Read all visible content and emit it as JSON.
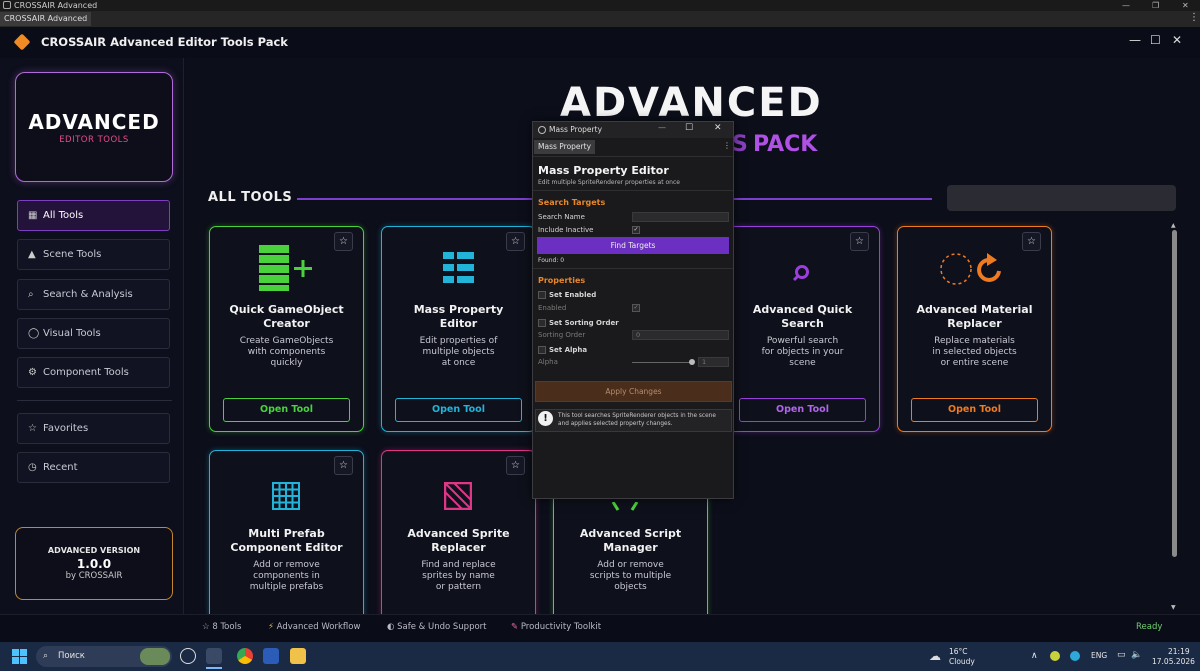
{
  "os": {
    "window_title": "CROSSAIR Advanced",
    "tab_label": "CROSSAIR Advanced"
  },
  "app": {
    "title": "CROSSAIR Advanced Editor Tools Pack",
    "minimize": "—",
    "maximize": "☐",
    "close": "✕"
  },
  "sidebar": {
    "logo_main": "ADVANCED",
    "logo_sub": "EDITOR TOOLS",
    "items": [
      {
        "icon": "▦",
        "label": "All Tools"
      },
      {
        "icon": "▲",
        "label": "Scene Tools"
      },
      {
        "icon": "⌕",
        "label": "Search & Analysis"
      },
      {
        "icon": "◯",
        "label": "Visual Tools"
      },
      {
        "icon": "⚙",
        "label": "Component Tools"
      }
    ],
    "extra": [
      {
        "icon": "☆",
        "label": "Favorites"
      },
      {
        "icon": "◷",
        "label": "Recent"
      }
    ],
    "version_label": "ADVANCED VERSION",
    "version": "1.0.0",
    "by": "by CROSSAIR"
  },
  "hero": {
    "title": "ADVANCED",
    "pack": "PACK",
    "partial": "S"
  },
  "section_title": "ALL TOOLS",
  "cards": [
    {
      "title1": "Quick GameObject",
      "title2": "Creator",
      "desc1": "Create GameObjects",
      "desc2": "with components",
      "desc3": "quickly",
      "btn": "Open Tool",
      "color": "#49d23c"
    },
    {
      "title1": "Mass Property",
      "title2": "Editor",
      "desc1": "Edit properties of",
      "desc2": "multiple objects",
      "desc3": "at once",
      "btn": "Open Tool",
      "color": "#22b4d8"
    },
    {
      "title1": "Advanced Quick",
      "title2": "Search",
      "desc1": "Powerful search",
      "desc2": "for objects in your",
      "desc3": "scene",
      "btn": "Open Tool",
      "color": "#9a3fdc"
    },
    {
      "title1": "Advanced Material",
      "title2": "Replacer",
      "desc1": "Replace materials",
      "desc2": "in selected objects",
      "desc3": "or entire scene",
      "btn": "Open Tool",
      "color": "#ee7a22"
    },
    {
      "title1": "Multi Prefab",
      "title2": "Component Editor",
      "desc1": "Add or remove",
      "desc2": "components in",
      "desc3": "multiple prefabs",
      "color": "#22b4d8"
    },
    {
      "title1": "Advanced Sprite",
      "title2": "Replacer",
      "desc1": "Find and replace",
      "desc2": "sprites by name",
      "desc3": "or pattern",
      "color": "#e0368a"
    },
    {
      "title1": "Advanced Script",
      "title2": "Manager",
      "desc1": "Add or remove",
      "desc2": "scripts to multiple",
      "desc3": "objects",
      "color": "#49d23c"
    }
  ],
  "star": "☆",
  "mass_property": {
    "window_title": "Mass Property",
    "tab": "Mass Property",
    "heading": "Mass Property Editor",
    "subheading": "Edit multiple SpriteRenderer properties at once",
    "search_section": "Search Targets",
    "search_name_label": "Search Name",
    "include_inactive_label": "Include Inactive",
    "find_button": "Find Targets",
    "found": "Found: 0",
    "properties_section": "Properties",
    "set_enabled": "Set Enabled",
    "enabled": "Enabled",
    "set_sorting_order": "Set Sorting Order",
    "sorting_order": "Sorting Order",
    "sorting_value": "0",
    "set_alpha": "Set Alpha",
    "alpha": "Alpha",
    "alpha_value": "1",
    "alpha_fraction": 1.0,
    "apply_button": "Apply Changes",
    "info_text": "This tool searches SpriteRenderer objects in the scene and applies selected property changes.",
    "check": "✓",
    "more": "⋮"
  },
  "status": {
    "items": [
      {
        "icon": "☆",
        "label": "8 Tools"
      },
      {
        "icon": "⚡",
        "label": "Advanced Workflow"
      },
      {
        "icon": "◐",
        "label": "Safe & Undo Support"
      },
      {
        "icon": "✎",
        "label": "Productivity Toolkit"
      }
    ],
    "ready": "Ready"
  },
  "taskbar": {
    "search_placeholder": "Поиск",
    "weather_temp": "16°C",
    "weather_desc": "Cloudy",
    "lang": "ENG",
    "time": "21:19",
    "date": "17.05.2026"
  }
}
